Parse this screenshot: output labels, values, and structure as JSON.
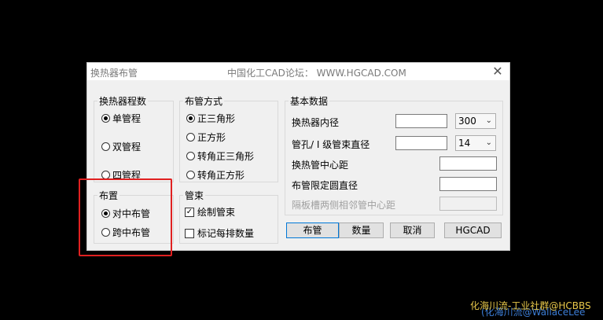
{
  "dialog": {
    "title": "换热器布管",
    "forum": "中国化工CAD论坛：  WWW.HGCAD.COM",
    "close": "✕"
  },
  "heat_exchanger_passes": {
    "legend": "换热器程数",
    "options": [
      "单管程",
      "双管程",
      "四管程"
    ],
    "selected": "单管程"
  },
  "layout": {
    "legend": "布置",
    "options": [
      "对中布管",
      "跨中布管"
    ],
    "selected": "对中布管"
  },
  "tube_pattern": {
    "legend": "布管方式",
    "options": [
      "正三角形",
      "正方形",
      "转角正三角形",
      "转角正方形"
    ],
    "selected": "正三角形"
  },
  "tube_bundle": {
    "legend": "管束",
    "draw_bundle": {
      "label": "绘制管束",
      "checked": true
    },
    "mark_rows": {
      "label": "标记每排数量",
      "checked": false
    }
  },
  "basic_data": {
    "legend": "基本数据",
    "inner_diameter": {
      "label": "换热器内径",
      "value": "",
      "select": "300"
    },
    "tube_hole": {
      "label": "管孔/ I 级管束直径",
      "value": "",
      "select": "14"
    },
    "center_distance": {
      "label": "换热管中心距",
      "value": ""
    },
    "limit_circle": {
      "label": "布管限定圆直径",
      "value": ""
    },
    "baffle_distance": {
      "label": "隔板槽两侧相邻管中心距",
      "value": ""
    }
  },
  "buttons": {
    "layout": "布管",
    "count": "数量",
    "cancel": "取消",
    "hgcad": "HGCAD"
  },
  "watermark": {
    "line1": "化海川流-工业社群@HCBBS",
    "line2": "(化海川流@WallaceLee"
  }
}
